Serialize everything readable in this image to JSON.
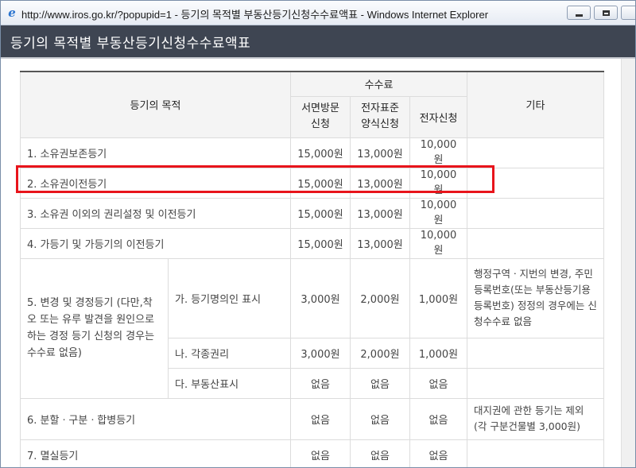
{
  "window": {
    "title": "http://www.iros.go.kr/?popupid=1 - 등기의 목적별 부동산등기신청수수료액표 - Windows Internet Explorer",
    "icon": "ie-logo-icon"
  },
  "page": {
    "title": "등기의 목적별 부동산등기신청수수료액표"
  },
  "table": {
    "headers": {
      "purpose": "등기의 목적",
      "fee_group": "수수료",
      "visit": "서면방문 신청",
      "efs": "전자표준 양식신청",
      "electronic": "전자신청",
      "etc": "기타"
    },
    "rows": [
      {
        "purpose": "1. 소유권보존등기",
        "visit": "15,000원",
        "efs": "13,000원",
        "electronic": "10,000원",
        "etc": ""
      },
      {
        "purpose": "2. 소유권이전등기",
        "visit": "15,000원",
        "efs": "13,000원",
        "electronic": "10,000원",
        "etc": ""
      },
      {
        "purpose": "3. 소유권 이외의 권리설정 및 이전등기",
        "visit": "15,000원",
        "efs": "13,000원",
        "electronic": "10,000원",
        "etc": ""
      },
      {
        "purpose": "4. 가등기 및 가등기의 이전등기",
        "visit": "15,000원",
        "efs": "13,000원",
        "electronic": "10,000원",
        "etc": ""
      }
    ],
    "group5": {
      "purpose": "5. 변경 및 경정등기 (다만,착오 또는 유루 발견을 원인으로 하는 경정 등기 신청의 경우는 수수료 없음)",
      "subrows": [
        {
          "label": "가. 등기명의인 표시",
          "visit": "3,000원",
          "efs": "2,000원",
          "electronic": "1,000원",
          "etc": "행정구역ㆍ지번의 변경, 주민등록번호(또는 부동산등기용등록번호) 정정의 경우에는 신청수수료 없음"
        },
        {
          "label": "나. 각종권리",
          "visit": "3,000원",
          "efs": "2,000원",
          "electronic": "1,000원",
          "etc": ""
        },
        {
          "label": "다. 부동산표시",
          "visit": "없음",
          "efs": "없음",
          "electronic": "없음",
          "etc": ""
        }
      ]
    },
    "row6": {
      "purpose": "6. 분할ㆍ구분ㆍ합병등기",
      "visit": "없음",
      "efs": "없음",
      "electronic": "없음",
      "etc": "대지권에 관한 등기는 제외 (각 구분건물별 3,000원)"
    },
    "row7": {
      "purpose": "7. 멸실등기",
      "visit": "없음",
      "efs": "없음",
      "electronic": "없음",
      "etc": ""
    }
  },
  "colors": {
    "header_bar": "#3e4552",
    "highlight_border": "#e8141b"
  }
}
